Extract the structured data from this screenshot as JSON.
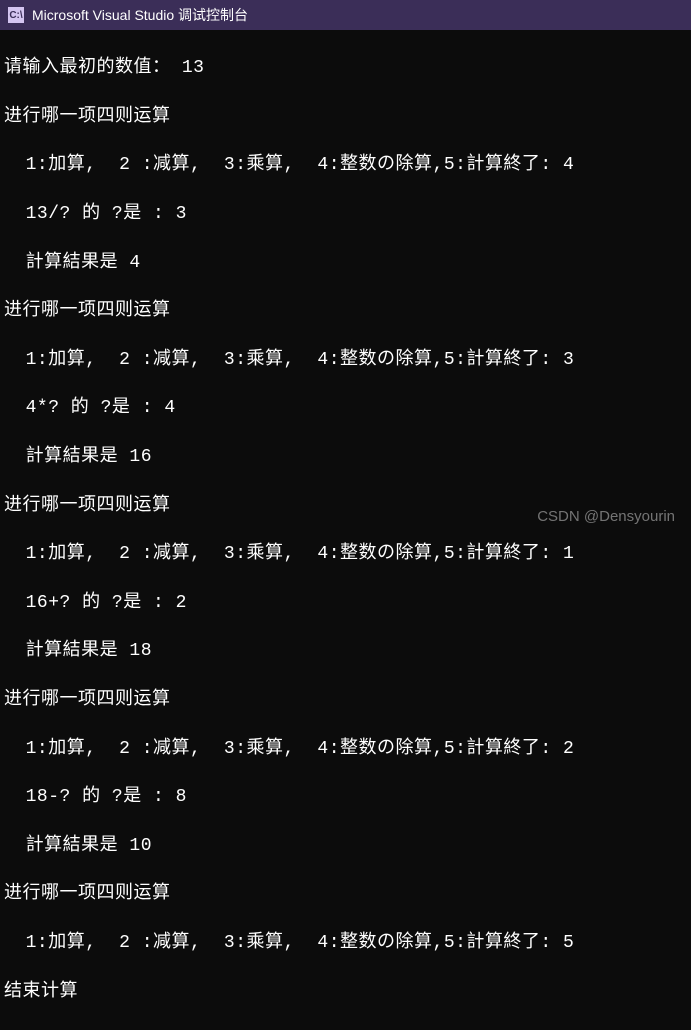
{
  "titlebar": {
    "icon_label": "C:\\",
    "title": "Microsoft Visual Studio 调试控制台"
  },
  "console": {
    "prompt_initial": "请输入最初的数值：",
    "initial_value": "13",
    "menu_header": "进行哪一项四则运算",
    "menu_options": "1:加算,  2 :减算,  3:乘算,  4:整数の除算,5:計算終了:",
    "rounds": [
      {
        "choice": "4",
        "question_prefix": "13/? 的 ?是 :",
        "answer": "3",
        "result_label": "計算結果是",
        "result_value": "4"
      },
      {
        "choice": "3",
        "question_prefix": "4*? 的 ?是 :",
        "answer": "4",
        "result_label": "計算結果是",
        "result_value": "16"
      },
      {
        "choice": "1",
        "question_prefix": "16+? 的 ?是 :",
        "answer": "2",
        "result_label": "計算結果是",
        "result_value": "18"
      },
      {
        "choice": "2",
        "question_prefix": "18-? 的 ?是 :",
        "answer": "8",
        "result_label": "計算結果是",
        "result_value": "10"
      }
    ],
    "final_choice": "5",
    "end_message": "结束计算"
  },
  "watermark": "CSDN @Densyourin"
}
